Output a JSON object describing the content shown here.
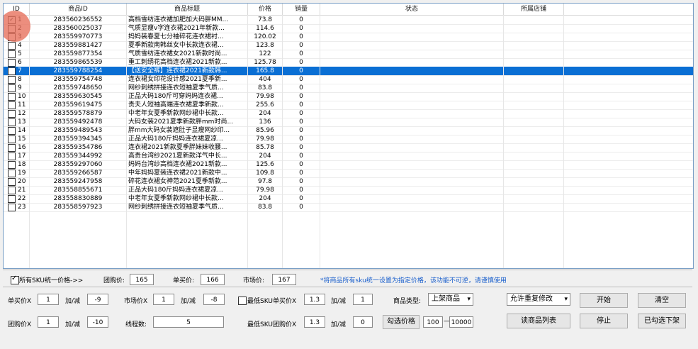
{
  "table": {
    "columns": [
      "ID",
      "商品ID",
      "商品标题",
      "价格",
      "销量",
      "状态",
      "所属店铺"
    ],
    "rows": [
      {
        "id": "1",
        "pid": "283560236552",
        "title": "高档雪纺连衣裙加肥加大码胖MM...",
        "price": "73.8",
        "sales": "0",
        "checked": true
      },
      {
        "id": "2",
        "pid": "283560025037",
        "title": "气质显瘦v字连衣裙2021年新款...",
        "price": "114.6",
        "sales": "0",
        "checked": false
      },
      {
        "id": "3",
        "pid": "283559970773",
        "title": "妈妈装春夏七分袖碎花连衣裙衬...",
        "price": "120.02",
        "sales": "0",
        "checked": false
      },
      {
        "id": "4",
        "pid": "283559881427",
        "title": "夏季新款南韩丝女中长款连衣裙...",
        "price": "123.8",
        "sales": "0",
        "checked": false
      },
      {
        "id": "5",
        "pid": "283559877354",
        "title": "气质雪纺连衣裙女2021新款时尚...",
        "price": "122",
        "sales": "0",
        "checked": false
      },
      {
        "id": "6",
        "pid": "283559865539",
        "title": "重工刺绣花高档连衣裙2021新款...",
        "price": "125.78",
        "sales": "0",
        "checked": false
      },
      {
        "id": "7",
        "pid": "283559788254",
        "title": "【送安全裤】连衣裙2021新款韩...",
        "price": "165.8",
        "sales": "0",
        "checked": false
      },
      {
        "id": "8",
        "pid": "283559754748",
        "title": "连衣裙女印花设计感2021夏季新...",
        "price": "404",
        "sales": "0",
        "checked": false
      },
      {
        "id": "9",
        "pid": "283559748650",
        "title": "网纱刺绣拼接连衣短袖夏季气质...",
        "price": "83.8",
        "sales": "0",
        "checked": false
      },
      {
        "id": "10",
        "pid": "283559630545",
        "title": "正品大码180斤可穿妈妈连衣裙...",
        "price": "79.98",
        "sales": "0",
        "checked": false
      },
      {
        "id": "11",
        "pid": "283559619475",
        "title": "贵夫人短袖高端连衣裙夏季新款...",
        "price": "255.6",
        "sales": "0",
        "checked": false
      },
      {
        "id": "12",
        "pid": "283559578879",
        "title": "中老年女夏季新款网纱裙中长款...",
        "price": "204",
        "sales": "0",
        "checked": false
      },
      {
        "id": "13",
        "pid": "283559492478",
        "title": "大码女装2021夏季新款胖mm时尚...",
        "price": "136",
        "sales": "0",
        "checked": false
      },
      {
        "id": "14",
        "pid": "283559489543",
        "title": "胖mm大码女装遮肚子显瘦网纱印...",
        "price": "85.96",
        "sales": "0",
        "checked": false
      },
      {
        "id": "15",
        "pid": "283559394345",
        "title": "正品大码180斤妈妈连衣裙夏凉...",
        "price": "79.98",
        "sales": "0",
        "checked": false
      },
      {
        "id": "16",
        "pid": "283559354786",
        "title": "连衣裙2021新款夏季胖妹妹收腰...",
        "price": "85.78",
        "sales": "0",
        "checked": false
      },
      {
        "id": "17",
        "pid": "283559344992",
        "title": "高贵台湾纱2021夏新款洋气中长...",
        "price": "204",
        "sales": "0",
        "checked": false
      },
      {
        "id": "18",
        "pid": "283559297060",
        "title": "妈妈台湾纱高档连衣裙2021新款...",
        "price": "125.6",
        "sales": "0",
        "checked": false
      },
      {
        "id": "19",
        "pid": "283559266587",
        "title": "中年妈妈夏装连衣裙2021新款中...",
        "price": "109.8",
        "sales": "0",
        "checked": false
      },
      {
        "id": "20",
        "pid": "283559247958",
        "title": "碎花连衣裙女神范2021夏季新款...",
        "price": "97.8",
        "sales": "0",
        "checked": false
      },
      {
        "id": "21",
        "pid": "283558855671",
        "title": "正品大码180斤妈妈连衣裙夏凉...",
        "price": "79.98",
        "sales": "0",
        "checked": false
      },
      {
        "id": "22",
        "pid": "283558830889",
        "title": "中老年女夏季新款网纱裙中长款...",
        "price": "204",
        "sales": "0",
        "checked": false
      },
      {
        "id": "23",
        "pid": "283558597923",
        "title": "网纱刺绣拼接连衣短袖夏季气质...",
        "price": "83.8",
        "sales": "0",
        "checked": false
      }
    ],
    "selected_index": 6
  },
  "unify": {
    "checkbox_label": "所有SKU统一价格->>",
    "checked": true,
    "group_label": "团购价:",
    "group_value": "165",
    "single_label": "单买价:",
    "single_value": "166",
    "market_label": "市场价:",
    "market_value": "167",
    "note": "*将商品所有sku统一设置为指定价格，该功能不可逆，请谨慎使用"
  },
  "controls": {
    "single_mult_label": "单买价X",
    "single_mult": "1",
    "plus_minus1": "加/减",
    "single_adj": "-9",
    "market_mult_label": "市场价X",
    "market_mult": "1",
    "plus_minus2": "加/减",
    "market_adj": "-8",
    "min_sku_single_label": "最低SKU单买价X",
    "min_sku_single": "1.3",
    "plus_minus3": "加/减",
    "min_sku_single_adj": "1",
    "product_type_label": "商品类型:",
    "product_type": "上架商品",
    "allow_modify": "允许重复修改",
    "start": "开始",
    "clear": "清空",
    "group_mult_label": "团购价X",
    "group_mult": "1",
    "plus_minus4": "加/减",
    "group_adj": "-10",
    "threads_label": "线程数:",
    "threads": "5",
    "min_sku_group_label": "最低SKU团购价X",
    "min_sku_group": "1.3",
    "plus_minus5": "加/减",
    "min_sku_group_adj": "0",
    "filter_price": "勾选价格",
    "range_min": "100",
    "range_dash": "—",
    "range_max": "10000",
    "read_list": "读商品列表",
    "stop": "停止",
    "delist": "已勾选下架"
  },
  "colors": {
    "selection": "#0a6fd4",
    "accent": "#1a5fcc"
  }
}
